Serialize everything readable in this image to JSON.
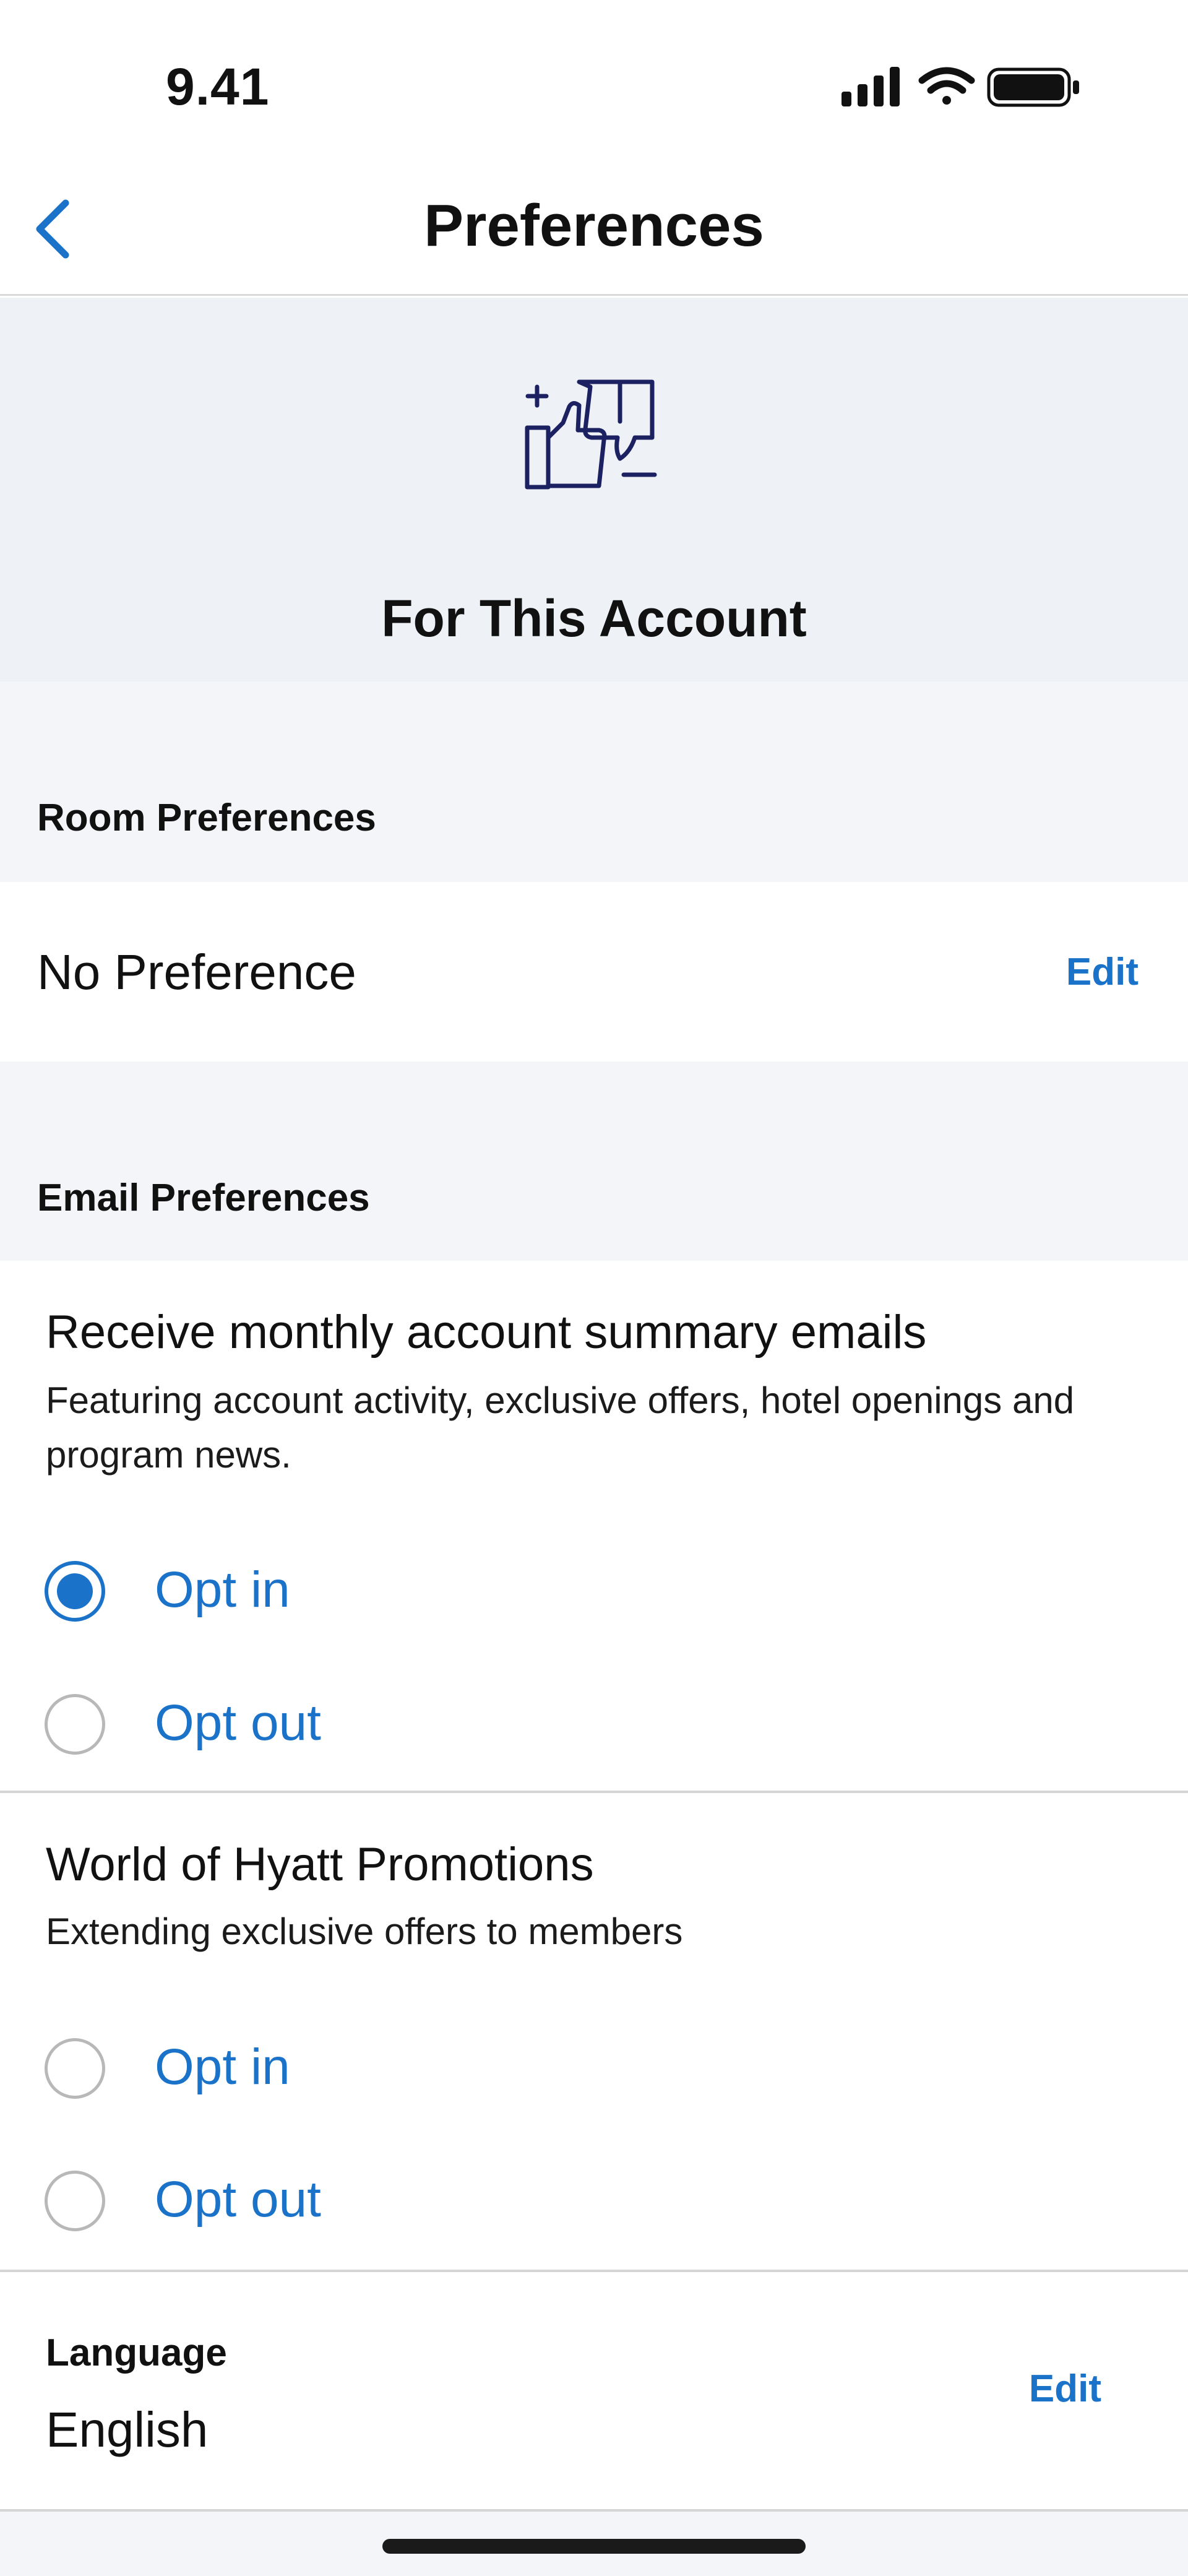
{
  "status_bar": {
    "time": "9.41"
  },
  "nav": {
    "title": "Preferences"
  },
  "hero": {
    "title": "For This Account"
  },
  "room_preferences": {
    "header": "Room Preferences",
    "value": "No Preference",
    "edit_label": "Edit"
  },
  "email_preferences": {
    "header": "Email Preferences",
    "groups": [
      {
        "title": "Receive monthly account summary emails",
        "description": "Featuring account activity, exclusive offers, hotel openings and program news.",
        "options": [
          {
            "label": "Opt in",
            "selected": true
          },
          {
            "label": "Opt out",
            "selected": false
          }
        ]
      },
      {
        "title": "World of Hyatt Promotions",
        "description": "Extending exclusive offers to members",
        "options": [
          {
            "label": "Opt in",
            "selected": false
          },
          {
            "label": "Opt out",
            "selected": false
          }
        ]
      }
    ]
  },
  "language": {
    "label": "Language",
    "value": "English",
    "edit_label": "Edit"
  },
  "colors": {
    "accent": "#1a73c9",
    "section_bg": "#eef2f7",
    "icon_navy": "#1c2161"
  }
}
